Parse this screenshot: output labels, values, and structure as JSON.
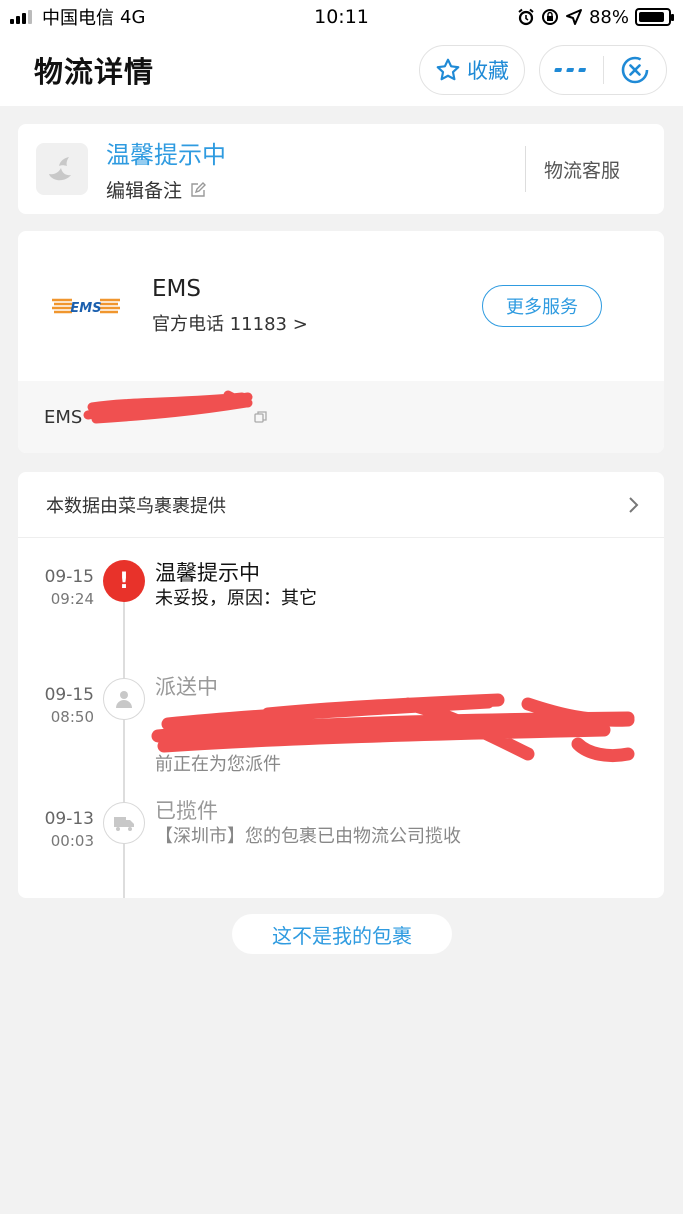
{
  "status_bar": {
    "carrier": "中国电信",
    "network": "4G",
    "time": "10:11",
    "battery": "88%",
    "battery_level": 0.88
  },
  "navbar": {
    "title": "物流详情",
    "favorite_label": "收藏"
  },
  "notice_card": {
    "title": "温馨提示中",
    "edit_note": "编辑备注",
    "service": "物流客服"
  },
  "courier_card": {
    "logo_text": "EMS",
    "name": "EMS",
    "phone": "官方电话 11183 >",
    "more_services": "更多服务",
    "tracking_prefix": "EMS"
  },
  "tracking_card": {
    "source": "本数据由菜鸟裹裹提供",
    "events": [
      {
        "date": "09-15",
        "time": "09:24",
        "title": "温馨提示中",
        "desc": "未妥投，原因：其它"
      },
      {
        "date": "09-15",
        "time": "08:50",
        "title": "派送中",
        "desc": "前正在为您派件"
      },
      {
        "date": "09-13",
        "time": "00:03",
        "title": "已揽件",
        "desc": "【深圳市】您的包裹已由物流公司揽收"
      }
    ]
  },
  "not_my_package": "这不是我的包裹",
  "colors": {
    "accent": "#2f9be0",
    "alert": "#e8322a",
    "redaction": "#f05050"
  }
}
